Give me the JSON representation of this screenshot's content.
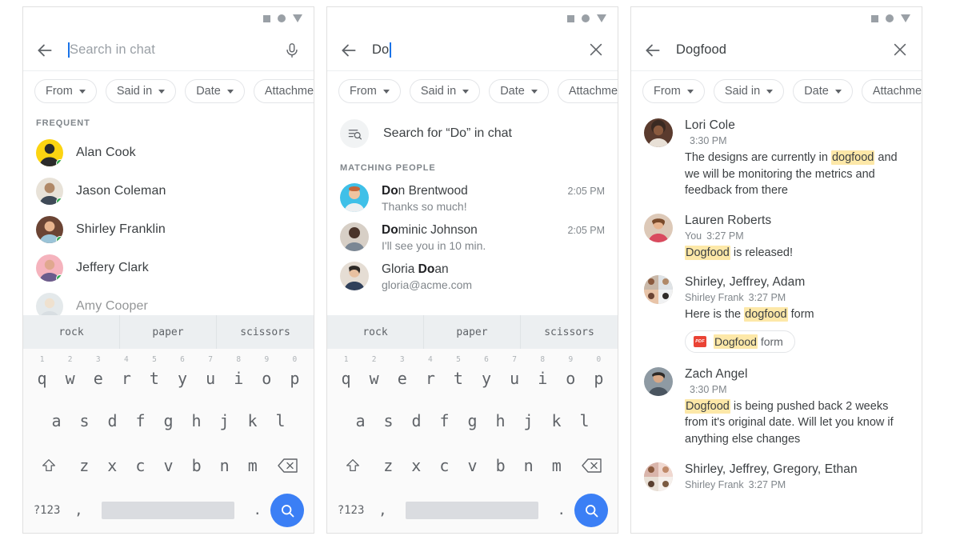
{
  "panel1": {
    "status_icons": [
      "square-icon",
      "circle-icon",
      "triangle-down-icon"
    ],
    "search": {
      "back_icon": "back-arrow-icon",
      "placeholder": "Search in chat",
      "value": "",
      "trailing_icon": "microphone-icon"
    },
    "chips": [
      {
        "label": "From"
      },
      {
        "label": "Said in"
      },
      {
        "label": "Date"
      },
      {
        "label": "Attachmer"
      }
    ],
    "section_label": "FREQUENT",
    "contacts": [
      {
        "name": "Alan Cook",
        "avatar_color": "#fcd411",
        "online": true
      },
      {
        "name": "Jason Coleman",
        "avatar_color": "#e8e2d8",
        "online": true
      },
      {
        "name": "Shirley Franklin",
        "avatar_color": "#6b4434",
        "online": true
      },
      {
        "name": "Jeffery Clark",
        "avatar_color": "#f5b3bd",
        "online": true
      },
      {
        "name": "Amy Cooper",
        "avatar_color": "#cfd8dc",
        "online": true
      }
    ],
    "keyboard": {
      "suggestions": [
        "rock",
        "paper",
        "scissors"
      ],
      "row1": [
        {
          "num": "1",
          "ch": "q"
        },
        {
          "num": "2",
          "ch": "w"
        },
        {
          "num": "3",
          "ch": "e"
        },
        {
          "num": "4",
          "ch": "r"
        },
        {
          "num": "5",
          "ch": "t"
        },
        {
          "num": "6",
          "ch": "y"
        },
        {
          "num": "7",
          "ch": "u"
        },
        {
          "num": "8",
          "ch": "i"
        },
        {
          "num": "9",
          "ch": "o"
        },
        {
          "num": "0",
          "ch": "p"
        }
      ],
      "row2": [
        "a",
        "s",
        "d",
        "f",
        "g",
        "h",
        "j",
        "k",
        "l"
      ],
      "row3": [
        "z",
        "x",
        "c",
        "v",
        "b",
        "n",
        "m"
      ],
      "shift_icon": "shift-icon",
      "backspace_icon": "backspace-icon",
      "sym_label": "?123",
      "comma_label": ",",
      "period_label": ".",
      "go_icon": "search-icon",
      "accent_blue": "#3b7ff5"
    }
  },
  "panel2": {
    "status_icons": [
      "square-icon",
      "circle-icon",
      "triangle-down-icon"
    ],
    "search": {
      "back_icon": "back-arrow-icon",
      "placeholder": "Search in chat",
      "value": "Do",
      "trailing_icon": "close-icon"
    },
    "chips": [
      {
        "label": "From"
      },
      {
        "label": "Said in"
      },
      {
        "label": "Date"
      },
      {
        "label": "Attachmer"
      }
    ],
    "search_for_row": {
      "icon": "search-in-chat-icon",
      "text": "Search for “Do” in chat"
    },
    "section_label": "MATCHING PEOPLE",
    "matches": [
      {
        "name_bold": "Do",
        "name_rest": "n Brentwood",
        "subtitle": "Thanks so much!",
        "time": "2:05 PM",
        "avatar_color": "#3fc0e8"
      },
      {
        "name_bold": "Do",
        "name_rest": "minic Johnson",
        "subtitle": "I'll see you in 10 min.",
        "time": "2:05 PM",
        "avatar_color": "#d7cfc6"
      },
      {
        "name_pre": "Gloria ",
        "name_bold": "Do",
        "name_rest": "an",
        "subtitle": "gloria@acme.com",
        "time": "",
        "avatar_color": "#e5ddd4"
      }
    ],
    "keyboard": {
      "suggestions": [
        "rock",
        "paper",
        "scissors"
      ],
      "row1": [
        {
          "num": "1",
          "ch": "q"
        },
        {
          "num": "2",
          "ch": "w"
        },
        {
          "num": "3",
          "ch": "e"
        },
        {
          "num": "4",
          "ch": "r"
        },
        {
          "num": "5",
          "ch": "t"
        },
        {
          "num": "6",
          "ch": "y"
        },
        {
          "num": "7",
          "ch": "u"
        },
        {
          "num": "8",
          "ch": "i"
        },
        {
          "num": "9",
          "ch": "o"
        },
        {
          "num": "0",
          "ch": "p"
        }
      ],
      "row2": [
        "a",
        "s",
        "d",
        "f",
        "g",
        "h",
        "j",
        "k",
        "l"
      ],
      "row3": [
        "z",
        "x",
        "c",
        "v",
        "b",
        "n",
        "m"
      ],
      "shift_icon": "shift-icon",
      "backspace_icon": "backspace-icon",
      "sym_label": "?123",
      "comma_label": ",",
      "period_label": ".",
      "go_icon": "search-icon",
      "accent_blue": "#3b7ff5"
    }
  },
  "panel3": {
    "status_icons": [
      "square-icon",
      "circle-icon",
      "triangle-down-icon"
    ],
    "search": {
      "back_icon": "back-arrow-icon",
      "value": "Dogfood",
      "trailing_icon": "close-icon"
    },
    "chips": [
      {
        "label": "From"
      },
      {
        "label": "Said in"
      },
      {
        "label": "Date"
      },
      {
        "label": "Attachme"
      }
    ],
    "highlight_color": "#fde8a8",
    "results": [
      {
        "title": "Lori Cole",
        "who": "",
        "time": "3:30 PM",
        "text_parts": [
          {
            "t": "The designs are currently in ",
            "hl": false
          },
          {
            "t": "dogfood",
            "hl": true
          },
          {
            "t": " and we will be monitoring the metrics and feedback from there",
            "hl": false
          }
        ],
        "avatar_color": "#5a3b2e",
        "attachment": null
      },
      {
        "title": "Lauren Roberts",
        "who": "You",
        "time": "3:27 PM",
        "text_parts": [
          {
            "t": "Dogfood",
            "hl": true
          },
          {
            "t": " is released!",
            "hl": false
          }
        ],
        "avatar_color": "#ddc9b8",
        "attachment": null
      },
      {
        "title": "Shirley, Jeffrey, Adam",
        "who": "Shirley Frank",
        "time": "3:27 PM",
        "text_parts": [
          {
            "t": "Here is the ",
            "hl": false
          },
          {
            "t": "dogfood",
            "hl": true
          },
          {
            "t": " form",
            "hl": false
          }
        ],
        "avatar_color": "#c9b8a8",
        "attachment": {
          "icon": "pdf-icon",
          "icon_label": "PDF",
          "name_hl": "Dogfood",
          "name_rest": " form"
        }
      },
      {
        "title": "Zach Angel",
        "who": "",
        "time": "3:30 PM",
        "text_parts": [
          {
            "t": "Dogfood",
            "hl": true
          },
          {
            "t": " is being pushed back 2 weeks from it's original date. Will let you know if anything else changes",
            "hl": false
          }
        ],
        "avatar_color": "#8e9aa3",
        "attachment": null
      },
      {
        "title": "Shirley, Jeffrey, Gregory, Ethan",
        "who": "Shirley Frank",
        "time": "3:27 PM",
        "text_parts": [],
        "avatar_color": "#d9b5ab",
        "attachment": null
      }
    ]
  }
}
